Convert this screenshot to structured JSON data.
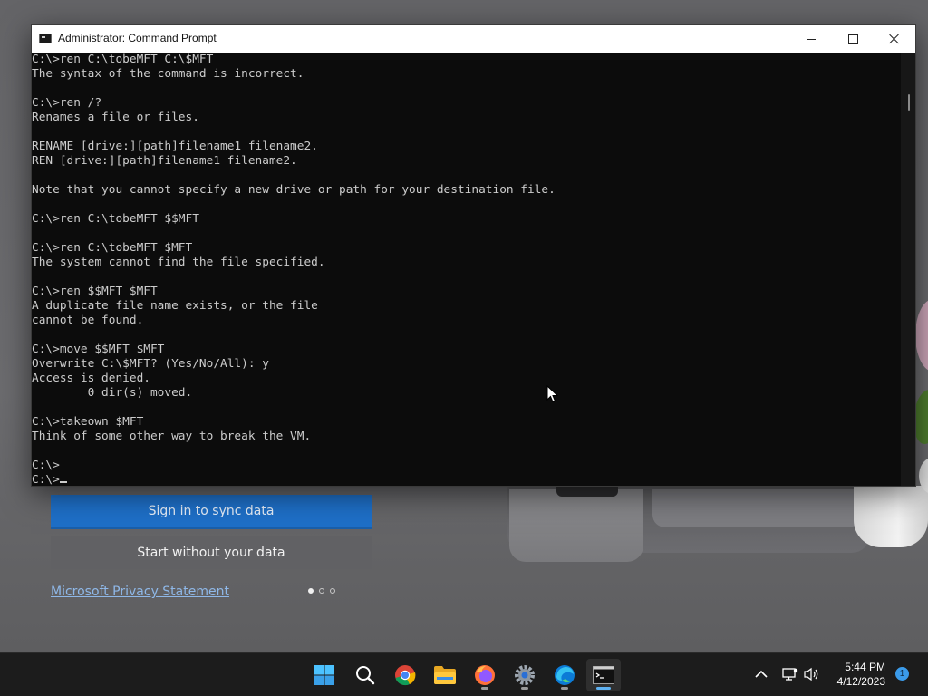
{
  "window": {
    "title": "Administrator: Command Prompt",
    "icon": "console-icon",
    "controls": [
      "minimize-icon",
      "maximize-icon",
      "close-icon"
    ]
  },
  "console": {
    "lines": [
      "C:\\>ren C:\\tobeMFT C:\\$MFT",
      "The syntax of the command is incorrect.",
      "",
      "C:\\>ren /?",
      "Renames a file or files.",
      "",
      "RENAME [drive:][path]filename1 filename2.",
      "REN [drive:][path]filename1 filename2.",
      "",
      "Note that you cannot specify a new drive or path for your destination file.",
      "",
      "C:\\>ren C:\\tobeMFT $$MFT",
      "",
      "C:\\>ren C:\\tobeMFT $MFT",
      "The system cannot find the file specified.",
      "",
      "C:\\>ren $$MFT $MFT",
      "A duplicate file name exists, or the file",
      "cannot be found.",
      "",
      "C:\\>move $$MFT $MFT",
      "Overwrite C:\\$MFT? (Yes/No/All): y",
      "Access is denied.",
      "        0 dir(s) moved.",
      "",
      "C:\\>takeown $MFT",
      "Think of some other way to break the VM.",
      "",
      "C:\\>",
      "C:\\>"
    ]
  },
  "background_app": {
    "sync_button": "Sign in to sync data",
    "no_data_button": "Start without your data",
    "privacy_link": "Microsoft Privacy Statement",
    "carousel_pages": 3,
    "carousel_active": 1
  },
  "taskbar": {
    "apps": [
      {
        "name": "start-icon",
        "active": false,
        "running": false
      },
      {
        "name": "search-icon",
        "active": false,
        "running": false
      },
      {
        "name": "chrome-icon",
        "active": false,
        "running": false
      },
      {
        "name": "file-explorer-icon",
        "active": false,
        "running": false
      },
      {
        "name": "firefox-icon",
        "active": false,
        "running": true
      },
      {
        "name": "settings-icon",
        "active": false,
        "running": true
      },
      {
        "name": "edge-icon",
        "active": false,
        "running": true
      },
      {
        "name": "terminal-icon",
        "active": true,
        "running": true
      }
    ],
    "tray_icons": [
      "chevron-up-icon",
      "network-icon",
      "volume-icon"
    ],
    "time": "5:44 PM",
    "date": "4/12/2023",
    "notification_count": "1"
  },
  "colors": {
    "console_bg": "#0c0c0c",
    "console_fg": "#cccccc",
    "accent": "#1e6fc7",
    "taskbar_bg": "#1c1c1c"
  }
}
